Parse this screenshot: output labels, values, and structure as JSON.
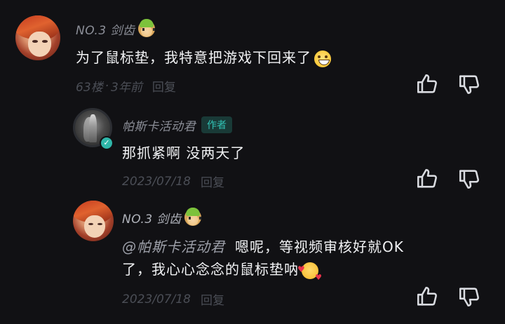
{
  "comments": [
    {
      "username": "NO.3 剑齿",
      "text": "为了鼠标垫，我特意把游戏下回来了",
      "floor": "63楼",
      "dot": "·",
      "time": "3年前",
      "reply_label": "回复"
    },
    {
      "username": "帕斯卡活动君",
      "badge": "作者",
      "verified": "✓",
      "text": "那抓紧啊 没两天了",
      "date": "2023/07/18",
      "reply_label": "回复"
    },
    {
      "username": "NO.3 剑齿",
      "mention": "@帕斯卡活动君",
      "text_line1": "嗯呢，等视频审核好就OK",
      "text_line2": "了，我心心念念的鼠标垫呐",
      "date": "2023/07/18",
      "reply_label": "回复"
    }
  ],
  "icons": {
    "like": "thumbs-up-icon",
    "dislike": "thumbs-down-icon"
  },
  "colors": {
    "background": "#111114",
    "text": "#ecedf0",
    "username": "#8b8e97",
    "meta": "#4b4e56",
    "badge_bg": "#193a37",
    "badge_text": "#31c2b4",
    "verified": "#2fb6a9"
  }
}
